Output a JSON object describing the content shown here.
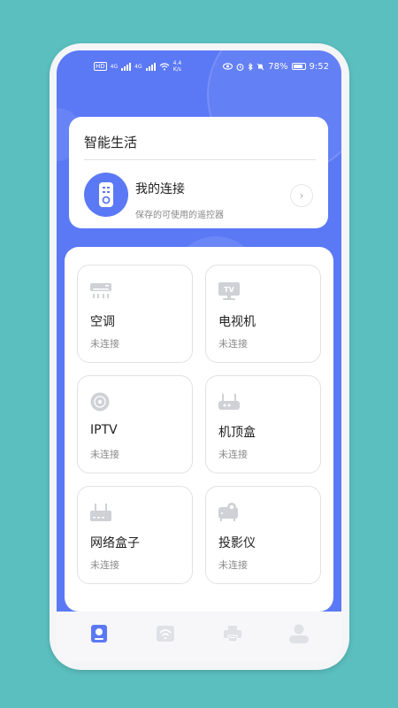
{
  "status_bar": {
    "network_chip": "HD",
    "net_label_1": "4G",
    "net_label_2": "4G",
    "speed": "4.4\nK/s",
    "battery": "78%",
    "time": "9:52"
  },
  "connection_card": {
    "title": "智能生活",
    "item_title": "我的连接",
    "item_subtitle": "保存的可使用的遥控器",
    "chevron": "›"
  },
  "devices": [
    {
      "name": "空调",
      "status": "未连接",
      "icon": "air-conditioner-icon"
    },
    {
      "name": "电视机",
      "status": "未连接",
      "icon": "tv-icon"
    },
    {
      "name": "IPTV",
      "status": "未连接",
      "icon": "disc-icon"
    },
    {
      "name": "机顶盒",
      "status": "未连接",
      "icon": "set-top-box-icon"
    },
    {
      "name": "网络盒子",
      "status": "未连接",
      "icon": "router-icon"
    },
    {
      "name": "投影仪",
      "status": "未连接",
      "icon": "projector-icon"
    }
  ],
  "tabbar": {
    "tabs": [
      "remote-tab",
      "wifi-tab",
      "printer-tab",
      "profile-tab"
    ],
    "active_index": 0
  },
  "colors": {
    "primary": "#5b79f5",
    "icon_gray": "#cfd1d6",
    "background": "#5bbfbf"
  }
}
